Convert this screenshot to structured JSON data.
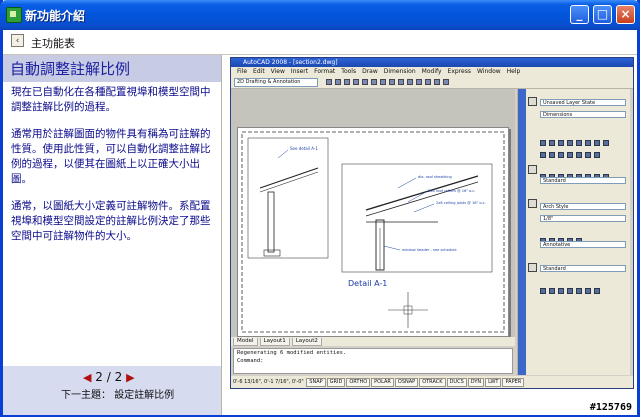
{
  "window": {
    "title": "新功能介紹",
    "minimize_icon": "minimize-icon",
    "maximize_icon": "maximize-icon",
    "close_icon": "close-icon"
  },
  "nav": {
    "back_label": "主功能表",
    "back_icon": "chevron-left-icon"
  },
  "topic": {
    "title": "自動調整註解比例",
    "paragraphs": [
      "現在已自動化在各種配置視埠和模型空間中調整註解比例的過程。",
      "通常用於註解圖面的物件具有稱為可註解的性質。使用此性質，可以自動化調整註解比例的過程，以便其在圖紙上以正確大小出圖。",
      "通常，以圖紙大小定義可註解物件。系配置視埠和模型空間設定的註解比例決定了那些空間中可註解物件的大小。"
    ]
  },
  "pager": {
    "current": "2",
    "separator": "/",
    "total": "2",
    "next_label": "下一主題：",
    "next_topic": "設定註解比例"
  },
  "screenshot": {
    "title": "AutoCAD 2008 - [section2.dwg]",
    "menu": [
      "File",
      "Edit",
      "View",
      "Insert",
      "Format",
      "Tools",
      "Draw",
      "Dimension",
      "Modify",
      "Express",
      "Window",
      "Help"
    ],
    "workspace": "2D Drafting & Annotation",
    "detail_label": "Detail A-1",
    "callouts": [
      "See detail A-1",
      "2x6 roof rafters @ 16\" o.c.",
      "2x6 ceiling joists @ 16\" o.c.",
      "window header - see schedule",
      "dia. roof sheathing"
    ],
    "tabs": [
      "Model",
      "Layout1",
      "Layout2"
    ],
    "command_lines": [
      "Regenerating 6 modified entities.",
      "Command:"
    ],
    "status_coord": "0'-6 13/16\", 0'-1 7/16\", 0'-0\"",
    "status_buttons": [
      "SNAP",
      "GRID",
      "ORTHO",
      "POLAR",
      "OSNAP",
      "OTRACK",
      "DUCS",
      "DYN",
      "LWT",
      "PAPER"
    ],
    "palette": {
      "layer_state": "Unsaved Layer State",
      "dimension_style": "Dimensions",
      "text_style": "Standard",
      "arch_style": "Arch Style",
      "scale": "1/8\"",
      "annotative": "Annotative",
      "standard2": "Standard"
    }
  },
  "watermark": "#125769"
}
